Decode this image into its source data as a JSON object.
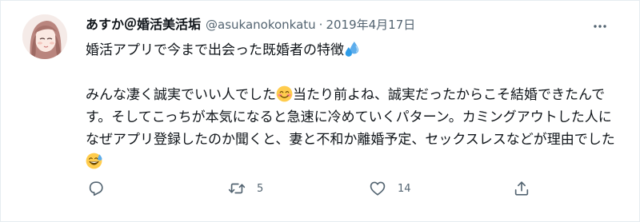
{
  "tweet": {
    "display_name": "あすか＠婚活美活垢",
    "handle": "@asukanokonkatu",
    "separator": "·",
    "timestamp": "2019年4月17日",
    "line1": "婚活アプリで今まで出会った既婚者の特徴",
    "p2_part1": "みんな凄く誠実でいい人でした",
    "p2_part2": "当たり前よね、誠実だったからこそ結婚できたんです。そしてこっちが本気になると急速に冷めていくパターン。カミングアウトした人になぜアプリ登録したのか聞くと、妻と不和か離婚予定、セックスレスなどが理由でした",
    "emojis": [
      "droplets-emoji",
      "smiling-face-emoji",
      "grinning-sweat-emoji"
    ]
  },
  "actions": {
    "reply_count": "",
    "retweet_count": "5",
    "like_count": "14"
  },
  "icons": {
    "reply": "reply-icon",
    "retweet": "retweet-icon",
    "like": "heart-icon",
    "share": "share-icon",
    "more": "more-dots-icon"
  },
  "colors": {
    "text_primary": "#0f1419",
    "text_secondary": "#536471",
    "emoji_blue": "#2f9ce8",
    "emoji_yellow": "#ffcc4d"
  }
}
